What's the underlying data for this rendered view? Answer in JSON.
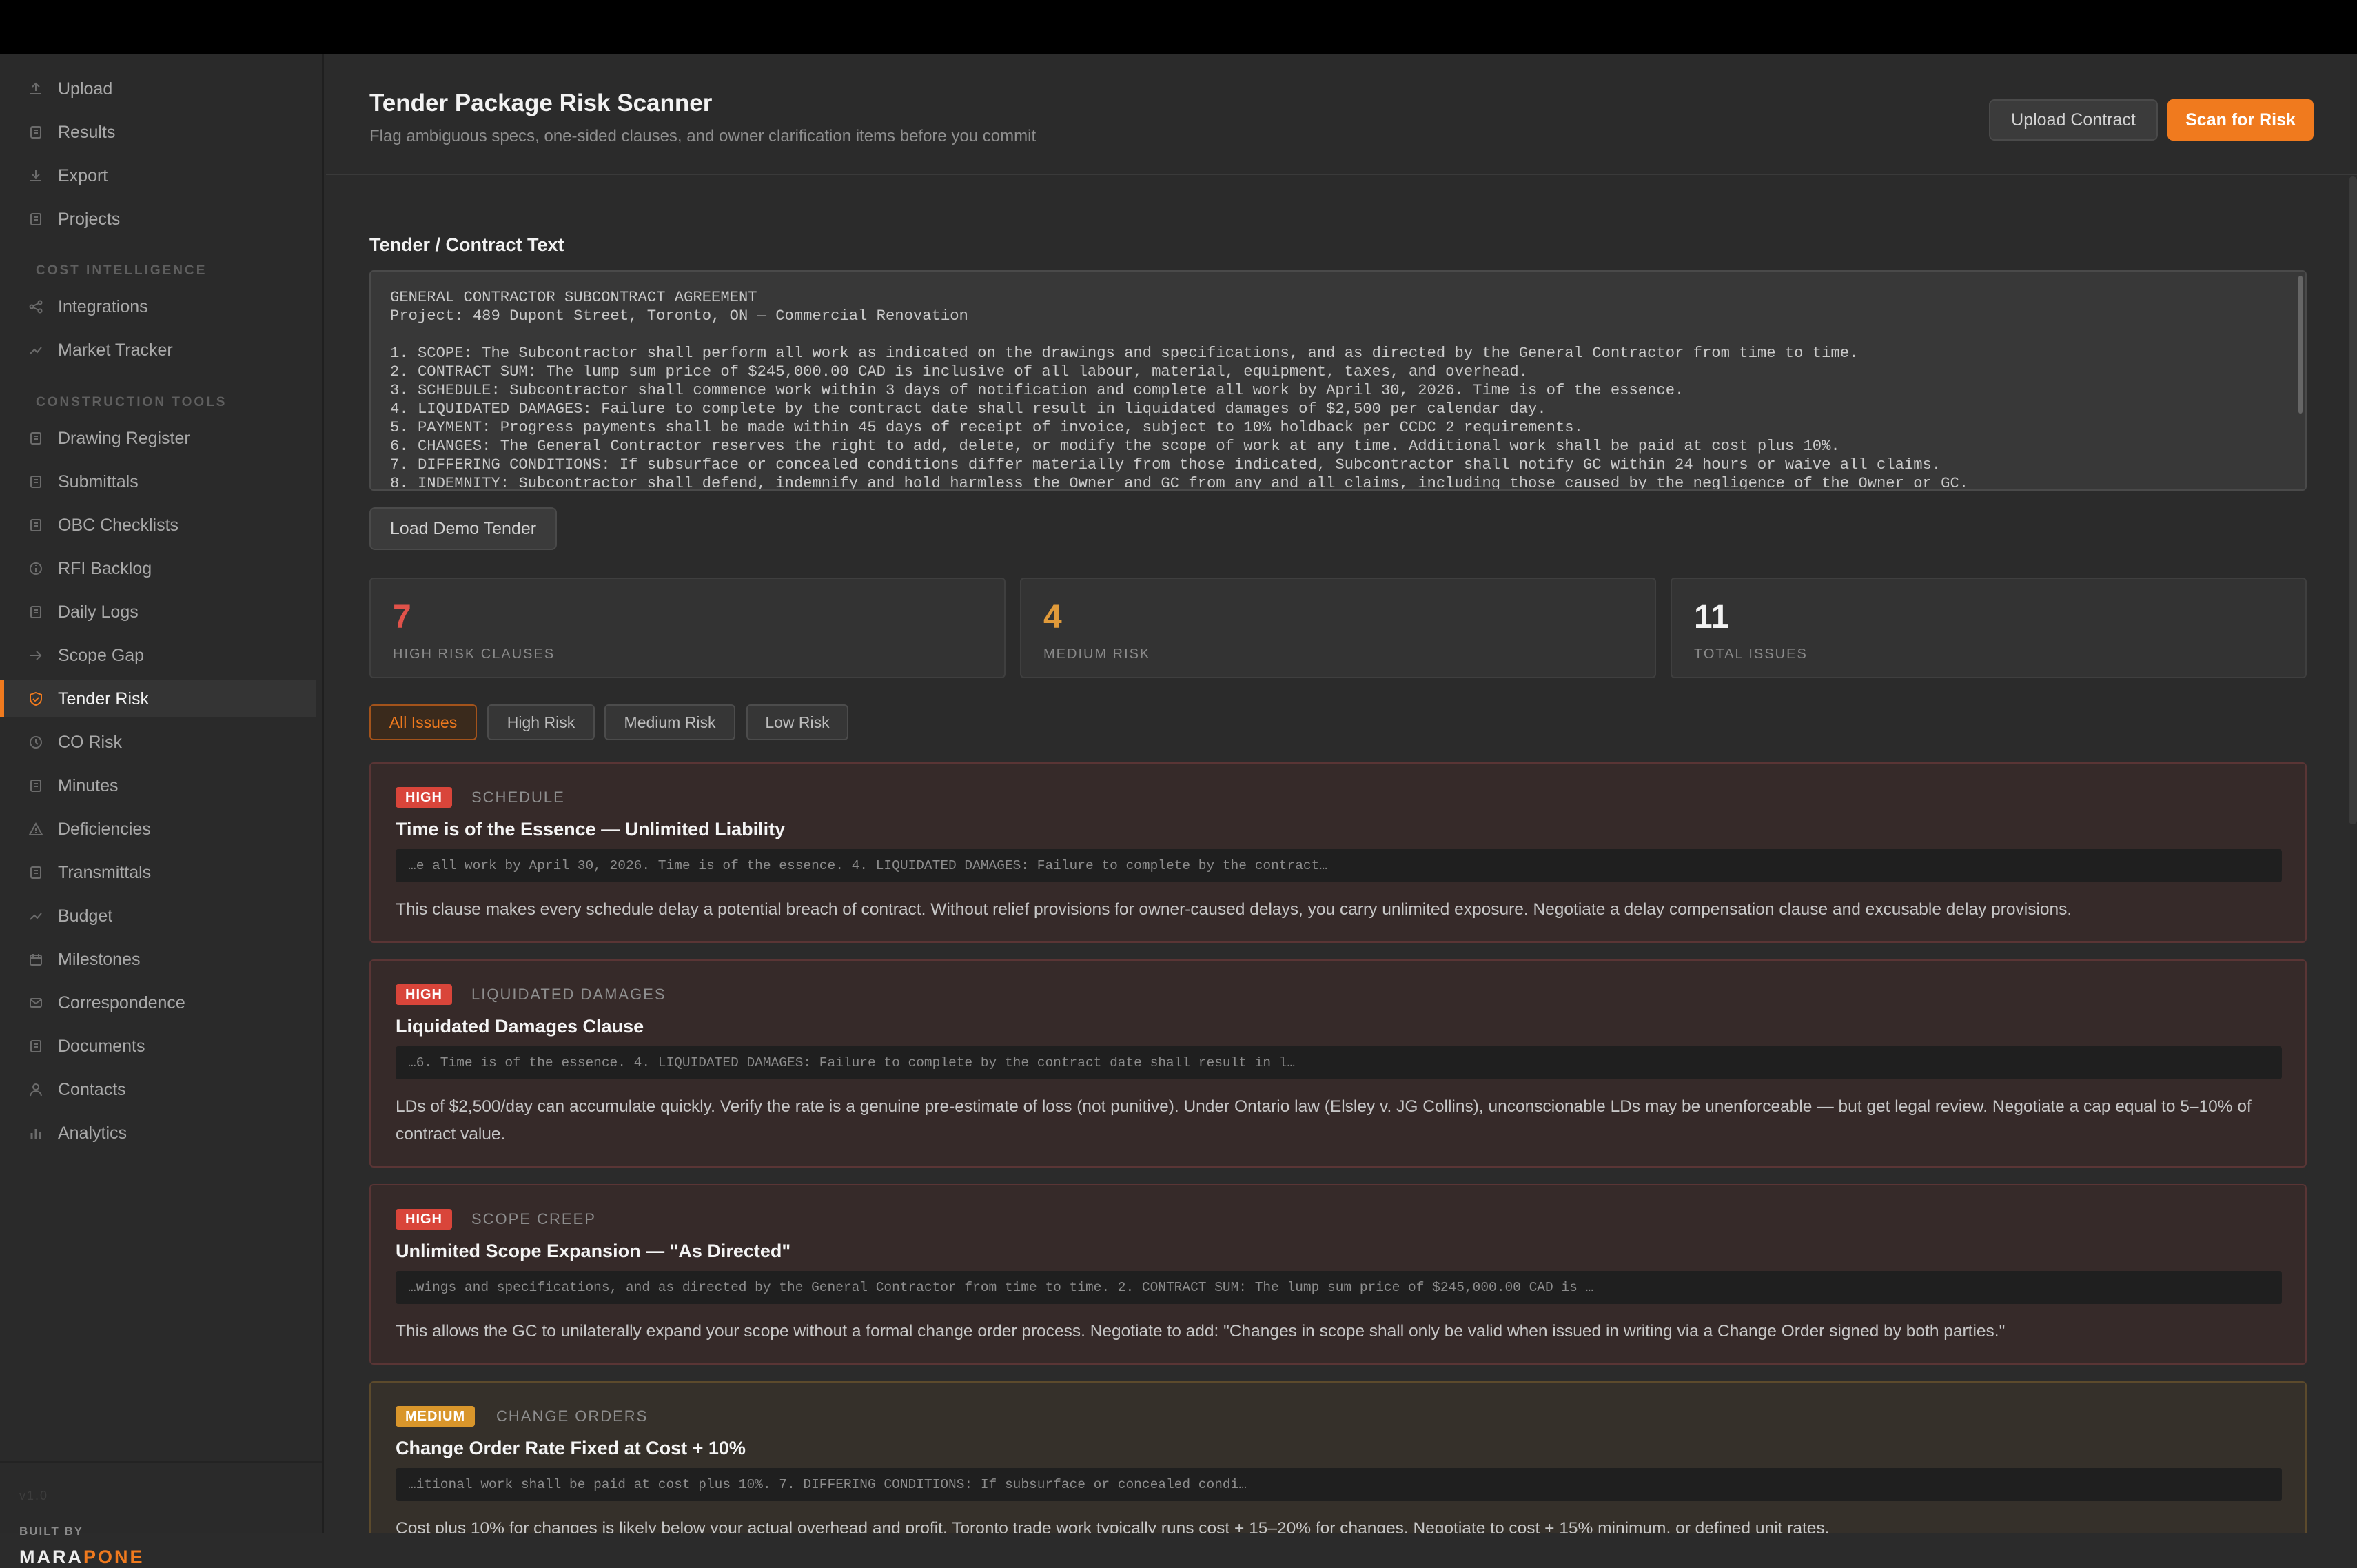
{
  "sidebar": {
    "items_top": [
      {
        "label": "Upload",
        "icon": "upload-icon"
      },
      {
        "label": "Results",
        "icon": "document-icon"
      },
      {
        "label": "Export",
        "icon": "download-icon"
      },
      {
        "label": "Projects",
        "icon": "folder-icon"
      }
    ],
    "section_cost": "COST INTELLIGENCE",
    "items_cost": [
      {
        "label": "Integrations",
        "icon": "share-icon"
      },
      {
        "label": "Market Tracker",
        "icon": "trend-icon"
      }
    ],
    "section_tools": "CONSTRUCTION TOOLS",
    "items_tools": [
      {
        "label": "Drawing Register",
        "icon": "document-icon"
      },
      {
        "label": "Submittals",
        "icon": "document-icon"
      },
      {
        "label": "OBC Checklists",
        "icon": "document-icon"
      },
      {
        "label": "RFI Backlog",
        "icon": "info-icon"
      },
      {
        "label": "Daily Logs",
        "icon": "document-icon"
      },
      {
        "label": "Scope Gap",
        "icon": "arrow-right-icon"
      },
      {
        "label": "Tender Risk",
        "icon": "shield-check-icon",
        "active": true
      },
      {
        "label": "CO Risk",
        "icon": "clock-icon"
      },
      {
        "label": "Minutes",
        "icon": "document-icon"
      },
      {
        "label": "Deficiencies",
        "icon": "warning-icon"
      },
      {
        "label": "Transmittals",
        "icon": "document-icon"
      },
      {
        "label": "Budget",
        "icon": "trend-icon"
      },
      {
        "label": "Milestones",
        "icon": "calendar-icon"
      },
      {
        "label": "Correspondence",
        "icon": "mail-icon"
      },
      {
        "label": "Documents",
        "icon": "document-icon"
      },
      {
        "label": "Contacts",
        "icon": "user-icon"
      },
      {
        "label": "Analytics",
        "icon": "bar-chart-icon"
      }
    ],
    "version": "v1.0",
    "built_by": "BUILT BY",
    "logo_a": "MARA",
    "logo_b": "PONE"
  },
  "header": {
    "title": "Tender Package Risk Scanner",
    "subtitle": "Flag ambiguous specs, one-sided clauses, and owner clarification items before you commit",
    "upload_label": "Upload Contract",
    "scan_label": "Scan for Risk"
  },
  "contract": {
    "label": "Tender / Contract Text",
    "lines": [
      "GENERAL CONTRACTOR SUBCONTRACT AGREEMENT",
      "Project: 489 Dupont Street, Toronto, ON — Commercial Renovation",
      "",
      "1. SCOPE: The Subcontractor shall perform all work as indicated on the drawings and specifications, and as directed by the General Contractor from time to time.",
      "2. CONTRACT SUM: The lump sum price of $245,000.00 CAD is inclusive of all labour, material, equipment, taxes, and overhead.",
      "3. SCHEDULE: Subcontractor shall commence work within 3 days of notification and complete all work by April 30, 2026. Time is of the essence.",
      "4. LIQUIDATED DAMAGES: Failure to complete by the contract date shall result in liquidated damages of $2,500 per calendar day.",
      "5. PAYMENT: Progress payments shall be made within 45 days of receipt of invoice, subject to 10% holdback per CCDC 2 requirements.",
      "6. CHANGES: The General Contractor reserves the right to add, delete, or modify the scope of work at any time. Additional work shall be paid at cost plus 10%.",
      "7. DIFFERING CONDITIONS: If subsurface or concealed conditions differ materially from those indicated, Subcontractor shall notify GC within 24 hours or waive all claims.",
      "8. INDEMNITY: Subcontractor shall defend, indemnify and hold harmless the Owner and GC from any and all claims, including those caused by the negligence of the Owner or GC."
    ],
    "demo_label": "Load Demo Tender"
  },
  "stats": [
    {
      "value": "7",
      "label": "HIGH RISK CLAUSES",
      "color": "#e0524a"
    },
    {
      "value": "4",
      "label": "MEDIUM RISK",
      "color": "#e09a3a"
    },
    {
      "value": "11",
      "label": "TOTAL ISSUES",
      "color": "#f2f2f2"
    }
  ],
  "filters": [
    "All Issues",
    "High Risk",
    "Medium Risk",
    "Low Risk"
  ],
  "issues": [
    {
      "level": "HIGH",
      "category": "SCHEDULE",
      "title": "Time is of the Essence — Unlimited Liability",
      "excerpt": "…e all work by April 30, 2026. Time is of the essence. 4. LIQUIDATED DAMAGES: Failure to complete by the contract…",
      "description": "This clause makes every schedule delay a potential breach of contract. Without relief provisions for owner-caused delays, you carry unlimited exposure. Negotiate a delay compensation clause and excusable delay provisions."
    },
    {
      "level": "HIGH",
      "category": "LIQUIDATED DAMAGES",
      "title": "Liquidated Damages Clause",
      "excerpt": "…6. Time is of the essence. 4. LIQUIDATED DAMAGES: Failure to complete by the contract date shall result in l…",
      "description": "LDs of $2,500/day can accumulate quickly. Verify the rate is a genuine pre-estimate of loss (not punitive). Under Ontario law (Elsley v. JG Collins), unconscionable LDs may be unenforceable — but get legal review. Negotiate a cap equal to 5–10% of contract value."
    },
    {
      "level": "HIGH",
      "category": "SCOPE CREEP",
      "title": "Unlimited Scope Expansion — \"As Directed\"",
      "excerpt": "…wings and specifications, and as directed by the General Contractor from time to time. 2. CONTRACT SUM: The lump sum price of $245,000.00 CAD is …",
      "description": "This allows the GC to unilaterally expand your scope without a formal change order process. Negotiate to add: \"Changes in scope shall only be valid when issued in writing via a Change Order signed by both parties.\""
    },
    {
      "level": "MEDIUM",
      "category": "CHANGE ORDERS",
      "title": "Change Order Rate Fixed at Cost + 10%",
      "excerpt": "…itional work shall be paid at cost plus 10%. 7. DIFFERING CONDITIONS: If subsurface or concealed condi…",
      "description": "Cost plus 10% for changes is likely below your actual overhead and profit. Toronto trade work typically runs cost + 15–20% for changes. Negotiate to cost + 15% minimum, or defined unit rates."
    }
  ],
  "colors": {
    "accent": "#f07a1e",
    "high": "#d9453a",
    "medium": "#d9962b"
  }
}
